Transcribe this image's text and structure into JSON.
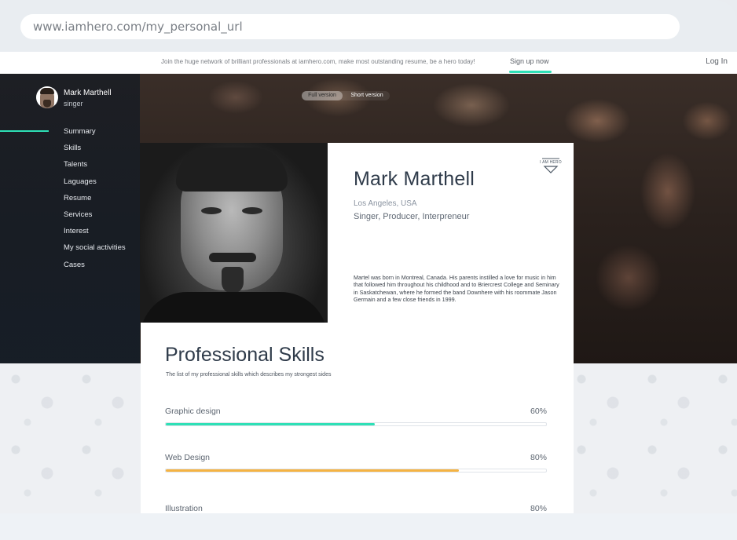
{
  "browser": {
    "url": "www.iamhero.com/my_personal_url"
  },
  "topbar": {
    "promo_text": "Join the huge network of brilliant professionals at iamhero.com, make most outstanding resume, be a hero today!",
    "signup_label": "Sign up now",
    "login_label": "Log In",
    "accent_color": "#2ee0b6"
  },
  "profile": {
    "name": "Mark Marthell",
    "role": "singer"
  },
  "nav": {
    "active_index": 0,
    "items": [
      {
        "label": "Summary"
      },
      {
        "label": "Skills"
      },
      {
        "label": "Talents"
      },
      {
        "label": "Laguages"
      },
      {
        "label": "Resume"
      },
      {
        "label": "Services"
      },
      {
        "label": "Interest"
      },
      {
        "label": "My social activities"
      },
      {
        "label": "Cases"
      }
    ]
  },
  "version_toggle": {
    "full_label": "Full version",
    "short_label": "Short version",
    "selected": "Full version"
  },
  "card": {
    "badge_text": "I AM HERO",
    "name": "Mark Marthell",
    "location": "Los Angeles, USA",
    "titles": "Singer, Producer, Interpreneur",
    "bio": "Martel was born in Montreal, Canada. His parents instilled a love for music in him that followed him throughout his childhood and to Briercrest College and Seminary in Saskatchewan, where he formed the band Downhere with his roommate Jason Germain and a few close friends in 1999."
  },
  "skills": {
    "title": "Professional Skills",
    "subtitle": "The list of my professional skills which describes my strongest sides",
    "items": [
      {
        "name": "Graphic design",
        "percent_label": "60%",
        "fill_fraction": 0.55,
        "color": "#2ee0b6"
      },
      {
        "name": "Web Design",
        "percent_label": "80%",
        "fill_fraction": 0.77,
        "color": "#f5b342"
      },
      {
        "name": "Illustration",
        "percent_label": "80%",
        "fill_fraction": 0.8,
        "color": "#8d7ff0"
      }
    ]
  }
}
